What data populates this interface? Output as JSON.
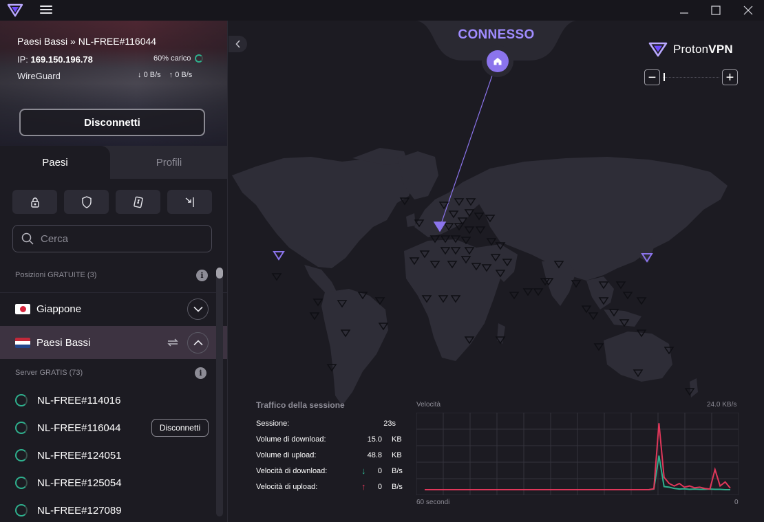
{
  "app": {
    "name": "ProtonVPN",
    "brand_light": "Proton",
    "brand_bold": "VPN",
    "accent_color": "#8b74ec",
    "success_color": "#2fb18e"
  },
  "titlebar": {
    "minimize_icon": "minimize-icon",
    "maximize_icon": "maximize-icon",
    "close_icon": "close-icon"
  },
  "connection": {
    "path": "Paesi Bassi » NL-FREE#116044",
    "ip_label": "IP:",
    "ip": "169.150.196.78",
    "load": "60% carico",
    "load_percent": 60,
    "protocol": "WireGuard",
    "download_rate": "0 B/s",
    "upload_rate": "0 B/s",
    "disconnect_label": "Disconnetti"
  },
  "tabs": [
    {
      "label": "Paesi",
      "active": true
    },
    {
      "label": "Profili",
      "active": false
    }
  ],
  "filters": [
    {
      "icon": "lock-icon"
    },
    {
      "icon": "shield-icon"
    },
    {
      "icon": "p2p-icon"
    },
    {
      "icon": "arrow-to-bar-icon"
    }
  ],
  "search": {
    "placeholder": "Cerca"
  },
  "free_locations": {
    "label": "Posizioni GRATUITE (3)"
  },
  "countries": [
    {
      "name": "Giappone",
      "flag": "JP",
      "expanded": false
    },
    {
      "name": "Paesi Bassi",
      "flag": "NL",
      "expanded": true
    }
  ],
  "free_servers": {
    "label": "Server GRATIS (73)",
    "servers": [
      {
        "name": "NL-FREE#114016",
        "load_percent": 60,
        "connected": false
      },
      {
        "name": "NL-FREE#116044",
        "load_percent": 60,
        "connected": true,
        "action": "Disconnetti"
      },
      {
        "name": "NL-FREE#124051",
        "load_percent": 60,
        "connected": false
      },
      {
        "name": "NL-FREE#125054",
        "load_percent": 60,
        "connected": false
      },
      {
        "name": "NL-FREE#127089",
        "load_percent": 60,
        "connected": false
      }
    ]
  },
  "map": {
    "status": "CONNESSO",
    "zoom_level_fraction": 0.02
  },
  "session": {
    "title": "Traffico della sessione",
    "rows": [
      {
        "label": "Sessione:",
        "value": "23s",
        "unit": ""
      },
      {
        "label": "Volume di download:",
        "value": "15.0",
        "unit": "KB"
      },
      {
        "label": "Volume di upload:",
        "value": "48.8",
        "unit": "KB"
      },
      {
        "label": "Velocità di download:",
        "value": "0",
        "unit": "B/s",
        "arrow": "↓",
        "arrow_color": "#2fb18e"
      },
      {
        "label": "Velocità di upload:",
        "value": "0",
        "unit": "B/s",
        "arrow": "↑",
        "arrow_color": "#e0375a"
      }
    ]
  },
  "chart_data": {
    "type": "line",
    "title": "Velocità",
    "ymax_label": "24.0  KB/s",
    "xlabel_left": "60 secondi",
    "xlabel_right": "0",
    "ylim": [
      0,
      24
    ],
    "x": [
      60,
      59,
      58,
      57,
      56,
      55,
      54,
      53,
      52,
      51,
      50,
      49,
      48,
      47,
      46,
      45,
      44,
      43,
      42,
      41,
      40,
      39,
      38,
      37,
      36,
      35,
      34,
      33,
      32,
      31,
      30,
      29,
      28,
      27,
      26,
      25,
      24,
      23,
      22,
      21,
      20,
      19,
      18,
      17,
      16,
      15,
      14,
      13,
      12,
      11,
      10,
      9,
      8,
      7,
      6,
      5,
      4,
      3,
      2,
      1,
      0
    ],
    "series": [
      {
        "name": "download",
        "color": "#2fb18e",
        "values": [
          0,
          0,
          0,
          0,
          0,
          0,
          0,
          0,
          0,
          0,
          0,
          0,
          0,
          0,
          0,
          0,
          0,
          0,
          0,
          0,
          0,
          0,
          0,
          0,
          0,
          0,
          0,
          0,
          0,
          0,
          0,
          0,
          0,
          0,
          0,
          0,
          0,
          0,
          0,
          0,
          0,
          0,
          0,
          0,
          0,
          0.2,
          11,
          1,
          0.8,
          0.4,
          0.2,
          0.3,
          0.1,
          0.2,
          0.1,
          0.1,
          0.2,
          0.1,
          0.1,
          0,
          0
        ]
      },
      {
        "name": "upload",
        "color": "#e0375a",
        "values": [
          0,
          0,
          0,
          0,
          0,
          0,
          0,
          0,
          0,
          0,
          0,
          0,
          0,
          0,
          0,
          0,
          0,
          0,
          0,
          0,
          0,
          0,
          0,
          0,
          0,
          0,
          0,
          0,
          0,
          0,
          0,
          0,
          0,
          0,
          0,
          0,
          0,
          0,
          0,
          0,
          0,
          0,
          0,
          0,
          0,
          0.3,
          21.5,
          4,
          2,
          1.2,
          2,
          0.8,
          1.2,
          0.6,
          0.8,
          0.4,
          0.2,
          6.5,
          1.2,
          2.5,
          0.5
        ]
      }
    ],
    "grid": true
  }
}
